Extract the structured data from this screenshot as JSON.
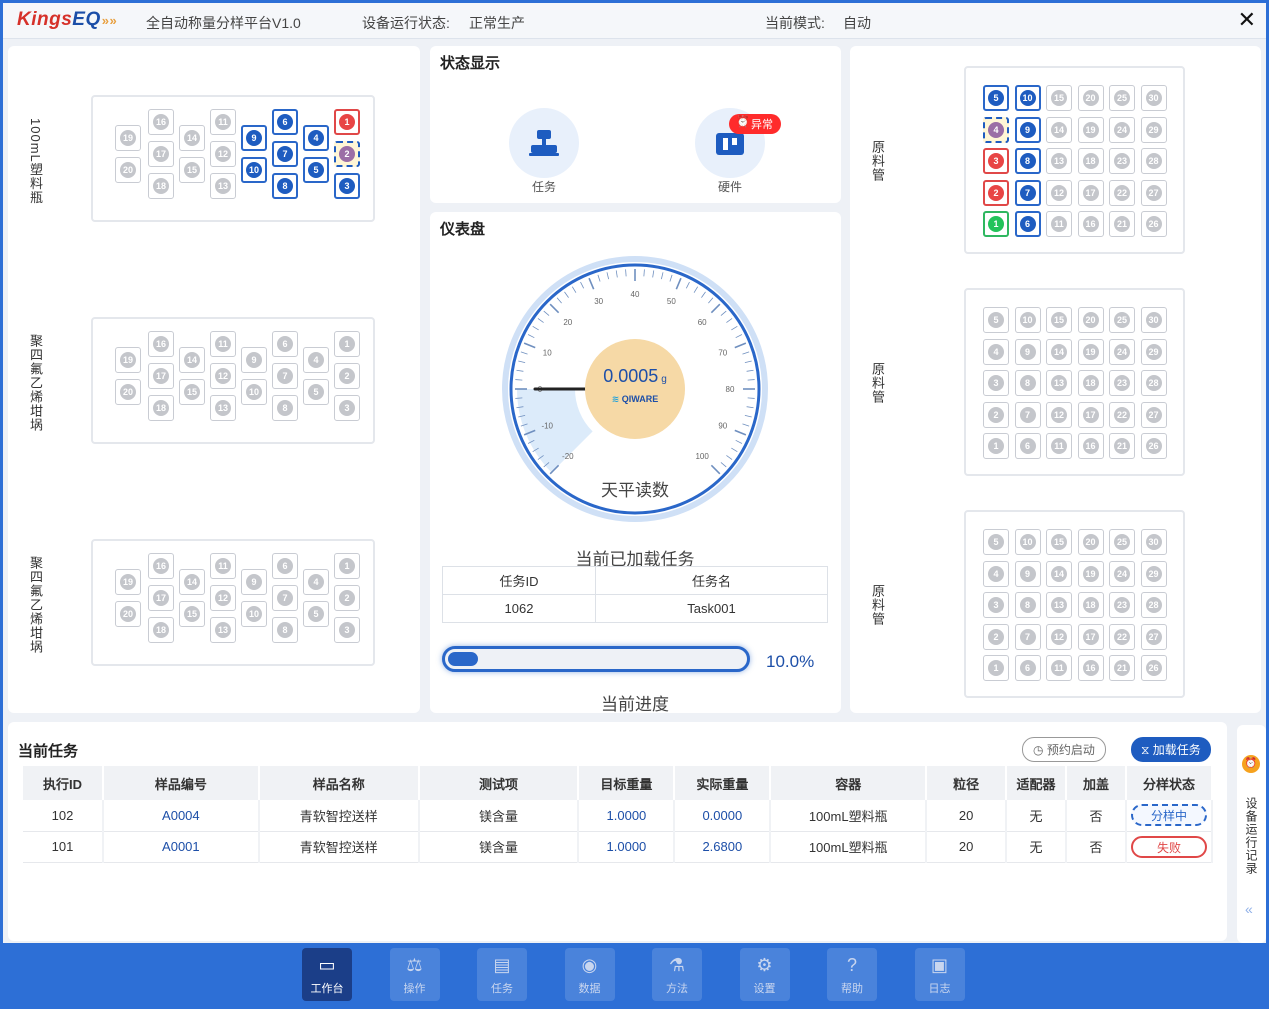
{
  "titlebar": {
    "logo_main": "Kings",
    "logo_accent": "EQ",
    "app_title": "全自动称量分样平台V1.0",
    "run_status_label": "设备运行状态:",
    "run_status_value": "正常生产",
    "mode_label": "当前模式:",
    "mode_value": "自动",
    "close": "✕"
  },
  "left_racks": [
    {
      "label": "100mL塑料瓶"
    },
    {
      "label": "聚四氟乙烯坩埚"
    },
    {
      "label": "聚四氟乙烯坩埚"
    }
  ],
  "right_racks": [
    {
      "label": "原料管"
    },
    {
      "label": "原料管"
    },
    {
      "label": "原料管"
    }
  ],
  "status": {
    "title": "状态显示",
    "task_label": "任务",
    "hardware_label": "硬件",
    "alarm_badge": "异常",
    "colors": {
      "accent": "#1e5cc0",
      "alarm": "#ff2b2b"
    }
  },
  "dashboard": {
    "title": "仪表盘",
    "reading": "0.0005",
    "unit": "g",
    "brand": "QIWARE",
    "caption": "天平读数",
    "gauge": {
      "min": -20,
      "max": 100,
      "value": 0.0005,
      "ticks": [
        "-20",
        "-10",
        "0",
        "10",
        "20",
        "30",
        "40",
        "50",
        "60",
        "70",
        "80",
        "90",
        "100"
      ]
    },
    "loaded_title": "当前已加载任务",
    "loaded_headers": [
      "任务ID",
      "任务名"
    ],
    "loaded_row": [
      "1062",
      "Task001"
    ],
    "progress_value": 0.1,
    "progress_text": "10.0%",
    "progress_caption": "当前进度"
  },
  "current_tasks": {
    "title": "当前任务",
    "schedule_button": "预约启动",
    "load_button": "加载任务",
    "columns": [
      "执行ID",
      "样品编号",
      "样品名称",
      "测试项",
      "目标重量",
      "实际重量",
      "容器",
      "粒径",
      "适配器",
      "加盖",
      "分样状态"
    ],
    "rows": [
      [
        "102",
        "A0004",
        "青软智控送样",
        "镁含量",
        "1.0000",
        "0.0000",
        "100mL塑料瓶",
        "20",
        "无",
        "否",
        "分样中"
      ],
      [
        "101",
        "A0001",
        "青软智控送样",
        "镁含量",
        "1.0000",
        "2.6800",
        "100mL塑料瓶",
        "20",
        "无",
        "否",
        "失败"
      ]
    ]
  },
  "side_rail": {
    "label": "设备运行记录"
  },
  "nav": [
    {
      "label": "工作台",
      "icon": "dashboard-icon"
    },
    {
      "label": "操作",
      "icon": "scale-icon"
    },
    {
      "label": "任务",
      "icon": "folder-icon"
    },
    {
      "label": "数据",
      "icon": "database-icon"
    },
    {
      "label": "方法",
      "icon": "flask-icon"
    },
    {
      "label": "设置",
      "icon": "gear-icon"
    },
    {
      "label": "帮助",
      "icon": "help-icon"
    },
    {
      "label": "日志",
      "icon": "log-icon"
    }
  ]
}
